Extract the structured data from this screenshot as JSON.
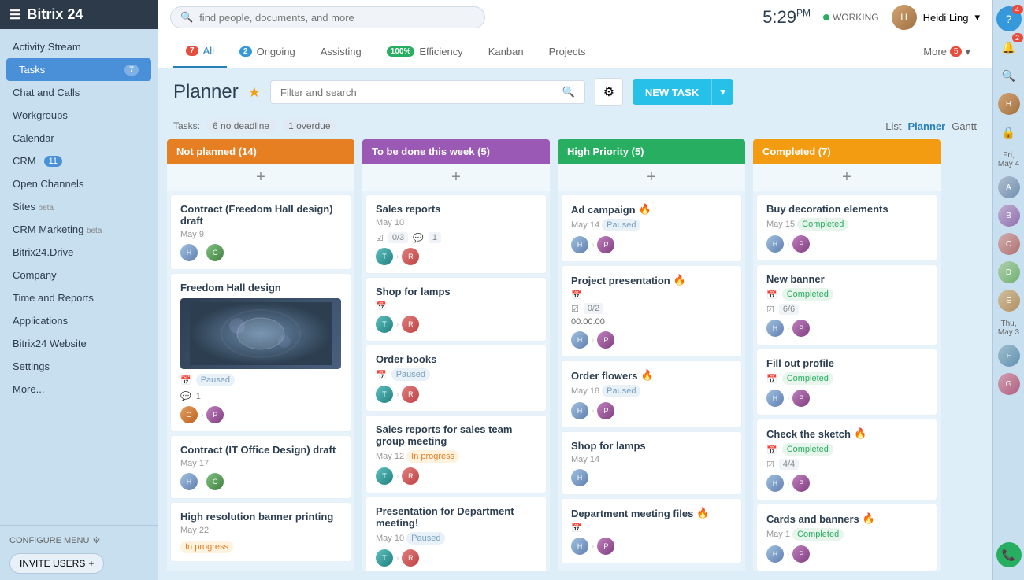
{
  "brand": {
    "name": "Bitrix",
    "number": "24"
  },
  "topbar": {
    "search_placeholder": "find people, documents, and more",
    "time": "5:29",
    "time_suffix": "PM",
    "status": "WORKING",
    "user_name": "Heidi Ling"
  },
  "sidebar": {
    "items": [
      {
        "label": "Activity Stream",
        "badge": ""
      },
      {
        "label": "Tasks",
        "badge": "7",
        "active": true
      },
      {
        "label": "Chat and Calls",
        "badge": ""
      },
      {
        "label": "Workgroups",
        "badge": ""
      },
      {
        "label": "Calendar",
        "badge": ""
      },
      {
        "label": "CRM",
        "badge": "11"
      },
      {
        "label": "Open Channels",
        "badge": ""
      },
      {
        "label": "Sites",
        "suffix": "beta",
        "badge": ""
      },
      {
        "label": "CRM Marketing",
        "suffix": "beta",
        "badge": ""
      },
      {
        "label": "Bitrix24.Drive",
        "badge": ""
      },
      {
        "label": "Company",
        "badge": ""
      },
      {
        "label": "Time and Reports",
        "badge": ""
      },
      {
        "label": "Applications",
        "badge": ""
      },
      {
        "label": "Bitrix24 Website",
        "badge": ""
      },
      {
        "label": "Settings",
        "badge": ""
      },
      {
        "label": "More...",
        "badge": ""
      }
    ],
    "configure_menu": "CONFIGURE MENU",
    "invite_users": "INVITE USERS"
  },
  "tabs": [
    {
      "label": "All",
      "badge": "7",
      "badge_color": "red",
      "active": true
    },
    {
      "label": "Ongoing",
      "badge": "2",
      "badge_color": "blue"
    },
    {
      "label": "Assisting",
      "badge": ""
    },
    {
      "label": "Efficiency",
      "badge": "100%",
      "badge_color": "green"
    },
    {
      "label": "Kanban",
      "badge": ""
    },
    {
      "label": "Projects",
      "badge": ""
    }
  ],
  "more_label": "More",
  "more_badge": "5",
  "planner": {
    "title": "Planner",
    "filter_placeholder": "Filter and search",
    "new_task": "NEW TASK",
    "tasks_label": "Tasks:",
    "no_deadline_count": "6",
    "no_deadline_label": "no deadline",
    "overdue_count": "1",
    "overdue_label": "overdue",
    "views": [
      "List",
      "Planner",
      "Gantt"
    ],
    "active_view": "Planner"
  },
  "columns": [
    {
      "id": "not-planned",
      "title": "Not planned",
      "count": 14,
      "color": "orange",
      "cards": [
        {
          "title": "Contract (Freedom Hall design) draft",
          "date": "May 9",
          "avatars": [
            "blue",
            "green"
          ]
        },
        {
          "title": "Freedom Hall design",
          "date": "",
          "image": true,
          "status": "Paused",
          "comment_count": "1",
          "avatars": [
            "orange",
            "purple"
          ]
        },
        {
          "title": "Contract (IT Office Design) draft",
          "date": "May 17",
          "avatars": [
            "blue",
            "green"
          ]
        },
        {
          "title": "High resolution banner printing",
          "date": "May 22",
          "status": "In progress",
          "avatars": []
        }
      ]
    },
    {
      "id": "to-be-done",
      "title": "To be done this week",
      "count": 5,
      "color": "purple",
      "cards": [
        {
          "title": "Sales reports",
          "date": "May 10",
          "check": "0/3",
          "comment": "1",
          "avatars": [
            "teal",
            "red"
          ]
        },
        {
          "title": "Shop for lamps",
          "date": "",
          "avatars": [
            "teal",
            "red"
          ]
        },
        {
          "title": "Order books",
          "date": "",
          "status": "Paused",
          "avatars": [
            "teal",
            "red"
          ]
        },
        {
          "title": "Sales reports for sales team group meeting",
          "date": "May 12",
          "status": "In progress",
          "avatars": [
            "teal",
            "red"
          ]
        },
        {
          "title": "Presentation for Department meeting!",
          "date": "May 10",
          "status": "Paused",
          "avatars": [
            "teal",
            "red"
          ]
        }
      ]
    },
    {
      "id": "high-priority",
      "title": "High Priority",
      "count": 5,
      "color": "green",
      "cards": [
        {
          "title": "Ad campaign",
          "date": "May 14",
          "status": "Paused",
          "fire": true,
          "avatars": [
            "blue",
            "purple"
          ]
        },
        {
          "title": "Project presentation",
          "date": "",
          "fire": true,
          "check": "0/2",
          "time": "00:00:00",
          "avatars": [
            "blue",
            "purple"
          ]
        },
        {
          "title": "Order flowers",
          "date": "May 18",
          "status": "Paused",
          "fire": true,
          "avatars": [
            "blue",
            "purple"
          ]
        },
        {
          "title": "Shop for lamps",
          "date": "May 14",
          "avatars": [
            "blue"
          ]
        },
        {
          "title": "Department meeting files",
          "date": "",
          "fire": true,
          "avatars": [
            "blue",
            "purple"
          ]
        }
      ]
    },
    {
      "id": "completed",
      "title": "Completed",
      "count": 7,
      "color": "yellow",
      "cards": [
        {
          "title": "Buy decoration elements",
          "date": "May 15",
          "status": "Completed",
          "avatars": [
            "blue",
            "purple"
          ]
        },
        {
          "title": "New banner",
          "date": "",
          "status": "Completed",
          "check": "6/6",
          "avatars": [
            "blue",
            "purple"
          ]
        },
        {
          "title": "Fill out profile",
          "date": "",
          "status": "Completed",
          "avatars": [
            "blue",
            "purple"
          ]
        },
        {
          "title": "Check the sketch",
          "date": "",
          "status": "Completed",
          "fire": true,
          "check": "4/4",
          "avatars": [
            "blue",
            "purple"
          ]
        },
        {
          "title": "Cards and banners",
          "date": "May 1",
          "status": "Completed",
          "fire": true,
          "avatars": [
            "blue",
            "purple"
          ]
        }
      ]
    }
  ],
  "right_sidebar": {
    "date1": "Fri, May 4",
    "date2": "Thu, May 3"
  }
}
